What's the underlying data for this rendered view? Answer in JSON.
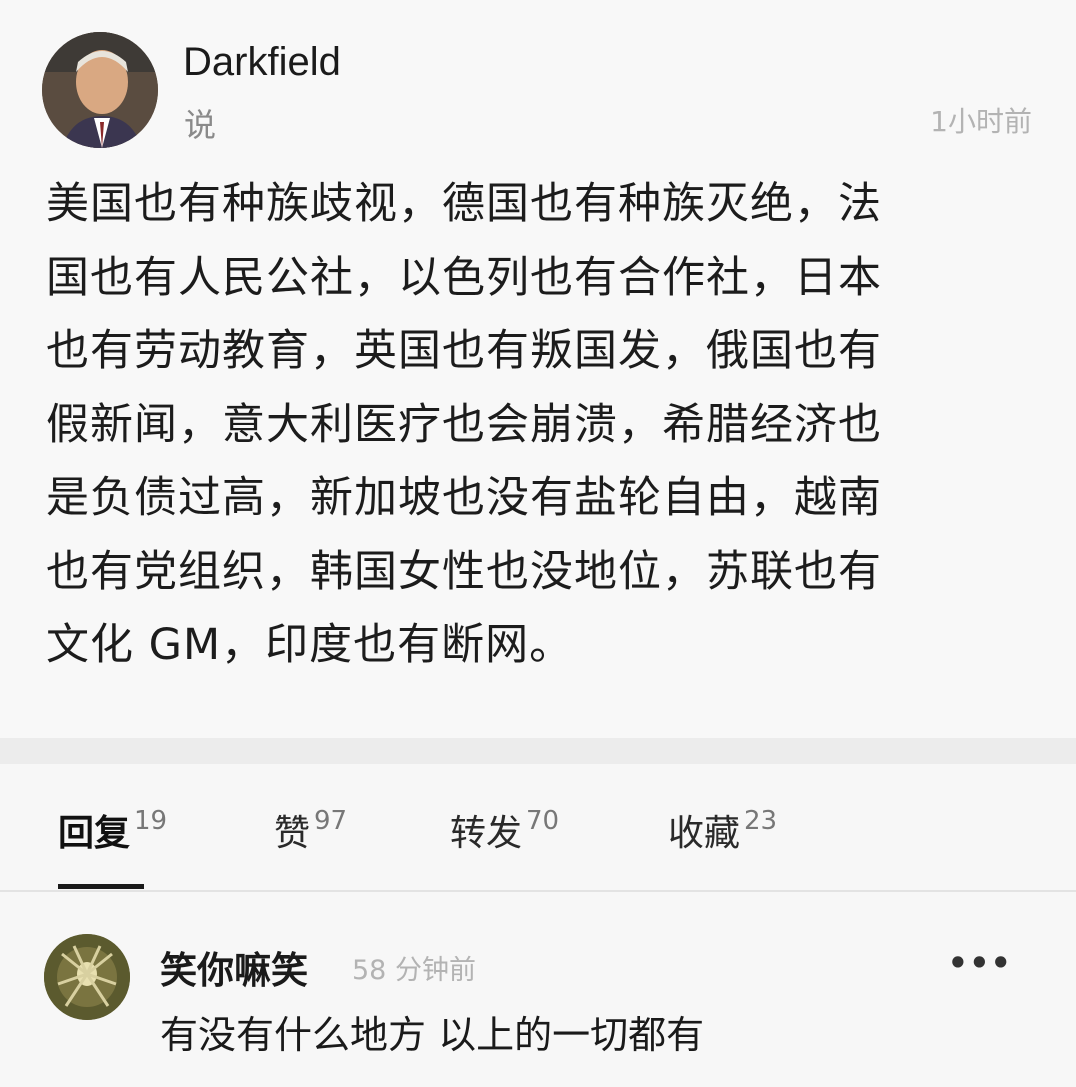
{
  "post": {
    "author": "Darkfield",
    "verb": "说",
    "time": "1小时前",
    "lines": [
      "美国也有种族歧视，德国也有种族灭绝，法",
      "国也有人民公社，以色列也有合作社，日本",
      "也有劳动教育，英国也有叛国发，俄国也有",
      "假新闻，意大利医疗也会崩溃，希腊经济也",
      "是负债过高，新加坡也没有盐轮自由，越南",
      "也有党组织，韩国女性也没地位，苏联也有",
      "文化 GM，印度也有断网。"
    ]
  },
  "tabs": [
    {
      "label": "回复",
      "count": "19",
      "active": true
    },
    {
      "label": "赞",
      "count": "97",
      "active": false
    },
    {
      "label": "转发",
      "count": "70",
      "active": false
    },
    {
      "label": "收藏",
      "count": "23",
      "active": false
    }
  ],
  "comment": {
    "name": "笑你嘛笑",
    "time": "58 分钟前",
    "text": "有没有什么地方 以上的一切都有",
    "more_icon": "more-dots-icon"
  }
}
